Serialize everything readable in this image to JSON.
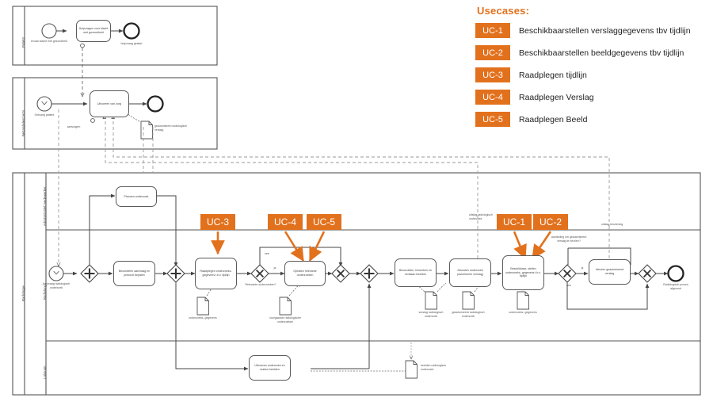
{
  "legend": {
    "title": "Usecases:",
    "items": [
      {
        "code": "UC-1",
        "text": "Beschikbaarstellen verslaggegevens tbv tijdlijn"
      },
      {
        "code": "UC-2",
        "text": "Beschikbaarstellen beeldgegevens tbv tijdlijn"
      },
      {
        "code": "UC-3",
        "text": "Raadplegen tijdlijn"
      },
      {
        "code": "UC-4",
        "text": "Raadplegen Verslag"
      },
      {
        "code": "UC-5",
        "text": "Raadplegen Beeld"
      }
    ],
    "accent_color": "#E2711D",
    "badge_text_color": "#FFFFFF"
  },
  "callouts": [
    {
      "code": "UC-3"
    },
    {
      "code": "UC-4"
    },
    {
      "code": "UC-5"
    },
    {
      "code": "UC-1"
    },
    {
      "code": "UC-2"
    }
  ],
  "pools": {
    "patient": {
      "lane_label": "Patiënt",
      "start_event_label": "ervaar klacht met gezondheid",
      "task_label": "Hulpvragen voor klacht met gezondheid",
      "end_event_label": "hulpvraag gestart"
    },
    "arts": {
      "lane_label": "Behandelend Arts",
      "start_event_label": "Ontvang patient",
      "task_label": "Uitvoeren van zorg",
      "message_label": "aanvragen",
      "data_object_label": "geautoriseerd radiologisch verslag"
    },
    "radiologie": {
      "pool_label": "Radiologie",
      "lanes": [
        "Administratief medewerker",
        "Radioloog",
        "Laborant"
      ],
      "start_event_label": "Aanvraag radiologisch onderzoek",
      "end_event_label": "Radiologisch proces afgerond",
      "tasks": {
        "plannen": "Plannen onderzoek",
        "beoordelen_aanvraag": "Beoordelen aanvraag en protocol bepalen",
        "raadplegen": "Raadplegen onderzoeks- gegevens t.b.v. tijdlijn",
        "ophalen": "Ophalen relevante onderzoeken",
        "beoordelen_beelden": "Beoordelen, bewerken en verslaan beelden",
        "afronden": "Afronden onderzoek (autoriseren verslag)",
        "beschikbaarstellen": "Beschikbaar- stellen onderzoeks- gegevens t.b.v. tijdlijn",
        "herzien": "Herzien geautoriseerd verslag",
        "uitvoeren_onderzoek": "Uitvoeren onderzoek en maken beelden"
      },
      "gateways": {
        "relevante": {
          "label": "Relevante onderzoeken?",
          "yes": "ja",
          "no": "nee"
        },
        "aanleiding": {
          "label": "Aanleiding om geautoriseerd verslag te herzien?",
          "yes": "ja",
          "no": "nee"
        }
      },
      "data_objects": [
        "onderzoeks- gegevens",
        "voorgaande radiologische onderzoeken",
        "verslag radiologisch onderzoek",
        "geautoriseerd radiologisch onderzoek",
        "onderzoeks- gegevens",
        "beelden radiologisch onderzoek"
      ],
      "message_labels": {
        "uitslag_onderzoek": "uitslag radiologisch onderzoek",
        "uitslag_herziening": "uitslag herziening"
      }
    }
  }
}
